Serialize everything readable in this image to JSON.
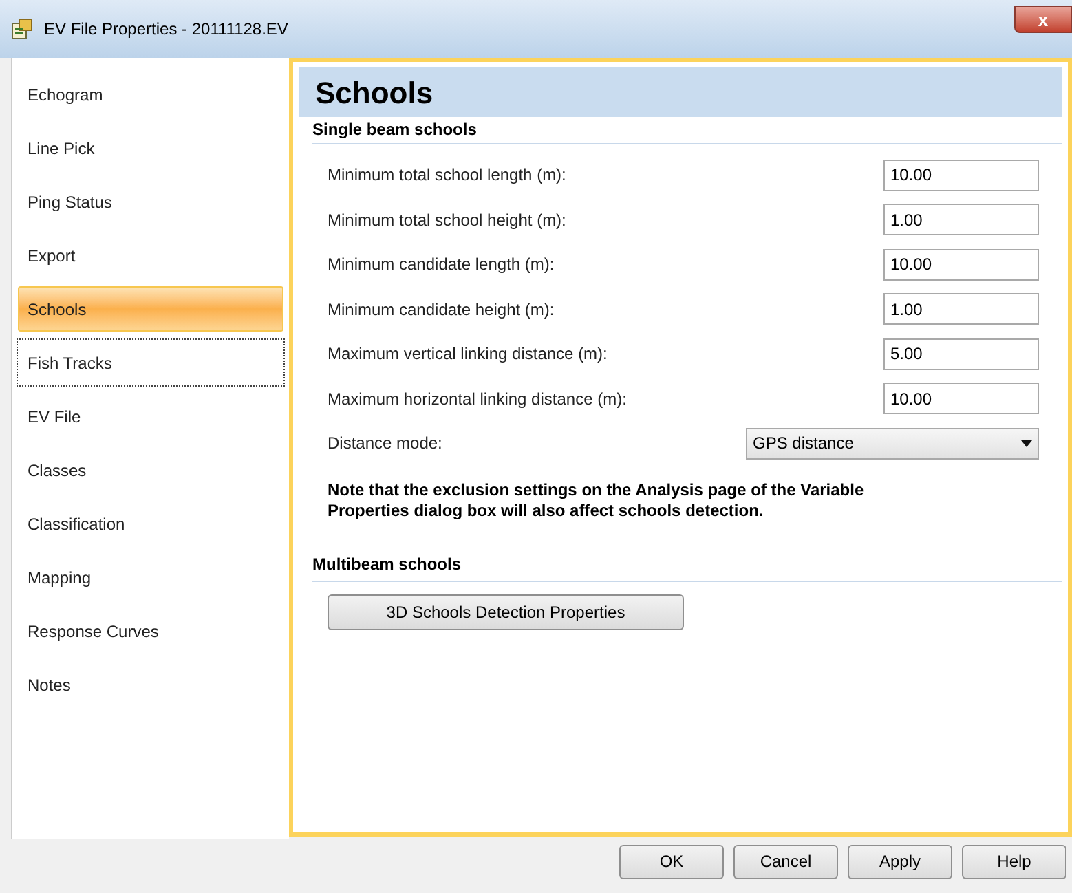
{
  "window": {
    "title": "EV File Properties - 20111128.EV",
    "close": "x"
  },
  "sidebar": {
    "items": [
      {
        "label": "Echogram",
        "selected": false,
        "focused": false
      },
      {
        "label": "Line Pick",
        "selected": false,
        "focused": false
      },
      {
        "label": "Ping Status",
        "selected": false,
        "focused": false
      },
      {
        "label": "Export",
        "selected": false,
        "focused": false
      },
      {
        "label": "Schools",
        "selected": true,
        "focused": false
      },
      {
        "label": "Fish Tracks",
        "selected": false,
        "focused": true
      },
      {
        "label": "EV File",
        "selected": false,
        "focused": false
      },
      {
        "label": "Classes",
        "selected": false,
        "focused": false
      },
      {
        "label": "Classification",
        "selected": false,
        "focused": false
      },
      {
        "label": "Mapping",
        "selected": false,
        "focused": false
      },
      {
        "label": "Response Curves",
        "selected": false,
        "focused": false
      },
      {
        "label": "Notes",
        "selected": false,
        "focused": false
      }
    ]
  },
  "page": {
    "title": "Schools",
    "single_beam": {
      "heading": "Single beam schools",
      "fields": [
        {
          "kind": "text",
          "label": "Minimum total school length (m):",
          "value": "10.00"
        },
        {
          "kind": "text",
          "label": "Minimum total school height (m):",
          "value": "1.00"
        },
        {
          "kind": "text",
          "label": "Minimum candidate length (m):",
          "value": "10.00"
        },
        {
          "kind": "text",
          "label": "Minimum candidate height (m):",
          "value": "1.00"
        },
        {
          "kind": "text",
          "label": "Maximum vertical linking distance (m):",
          "value": "5.00"
        },
        {
          "kind": "text",
          "label": "Maximum horizontal linking distance (m):",
          "value": "10.00"
        },
        {
          "kind": "dropdown",
          "label": "Distance mode:",
          "value": "GPS distance"
        }
      ],
      "note": "Note that the exclusion settings on the Analysis page of the Variable Properties dialog box will also affect schools detection."
    },
    "multibeam": {
      "heading": "Multibeam schools",
      "button": "3D Schools Detection Properties"
    }
  },
  "buttons": [
    "OK",
    "Cancel",
    "Apply",
    "Help"
  ]
}
